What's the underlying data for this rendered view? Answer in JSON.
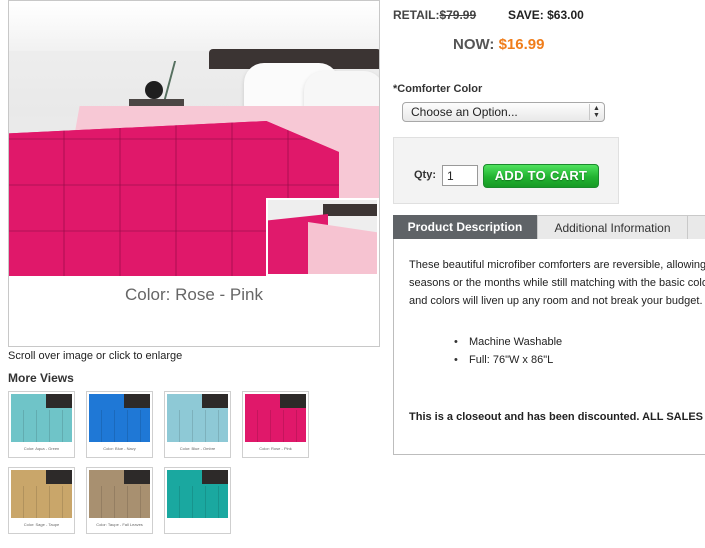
{
  "pricing": {
    "retail_label": "RETAIL:",
    "retail_price": "$79.99",
    "save_text": "SAVE: $63.00",
    "now_label": "NOW:",
    "now_price": "$16.99"
  },
  "options": {
    "label": "*Comforter Color",
    "selected": "Choose an Option..."
  },
  "cart": {
    "qty_label": "Qty:",
    "qty_value": "1",
    "add_button": "ADD TO CART"
  },
  "main_image": {
    "caption": "Color: Rose - Pink"
  },
  "scroll_hint": "Scroll over image or click to enlarge",
  "more_views_title": "More Views",
  "thumbnails": [
    {
      "label": "Color: Aqua - Green",
      "color": "#6fc4c8"
    },
    {
      "label": "Color: Blue - Navy",
      "color": "#1f78d6"
    },
    {
      "label": "Color: Blue - Ombre",
      "color": "#8ec9d6"
    },
    {
      "label": "Color: Rose - Pink",
      "color": "#e0186a"
    },
    {
      "label": "Color: Sage - Taupe",
      "color": "#c9a66a"
    },
    {
      "label": "Color: Taupe - Fall Leaves",
      "color": "#a89070"
    },
    {
      "label": "",
      "color": "#1aa8a0"
    }
  ],
  "tabs": {
    "active": "Product Description",
    "inactive": "Additional Information"
  },
  "description": {
    "line1": "These beautiful microfiber comforters are reversible, allowing",
    "line2": "seasons or the months while still matching with the basic colo",
    "line3": "and colors will liven up any room and not break your budget.",
    "features": [
      "Machine Washable",
      "Full: 76\"W x 86\"L"
    ],
    "closeout": "This is a closeout and has been discounted. ALL SALES"
  },
  "colors": {
    "price_orange": "#f07d1a",
    "cart_green": "#22b331",
    "active_tab": "#5f6367"
  }
}
